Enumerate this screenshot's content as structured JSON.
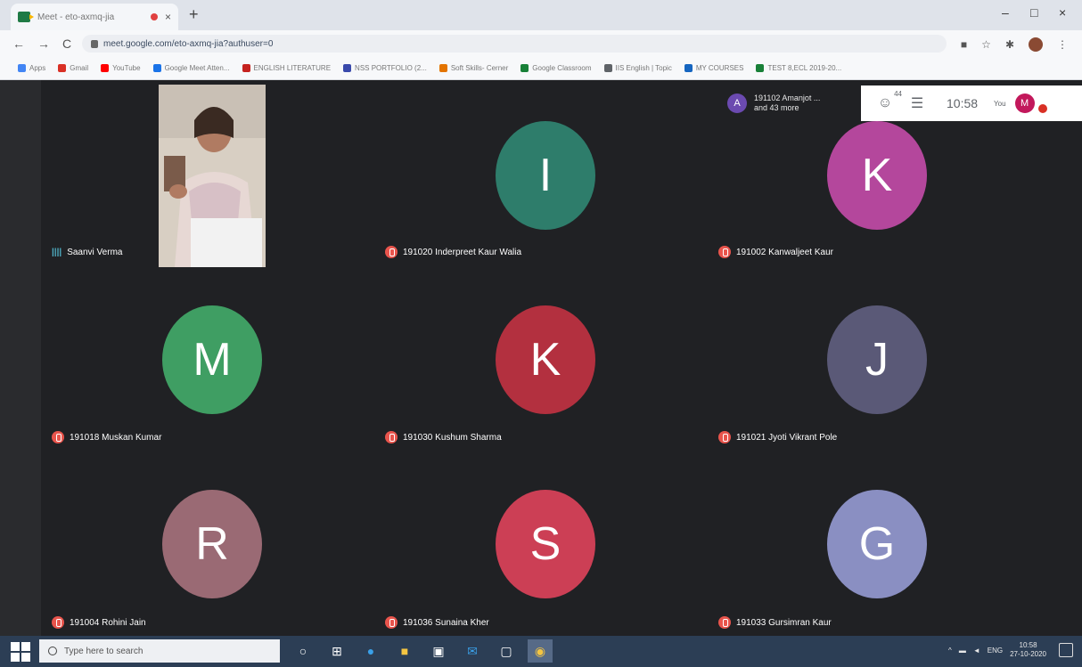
{
  "browser": {
    "tab_title": "Meet - eto-axmq-jia",
    "url": "meet.google.com/eto-axmq-jia?authuser=0",
    "window_controls": {
      "minimize": "–",
      "maximize": "□",
      "close": "×"
    },
    "nav": {
      "back": "←",
      "forward": "→",
      "reload": "C"
    },
    "new_tab": "+"
  },
  "bookmarks": [
    {
      "label": "Apps",
      "color": "#4285f4"
    },
    {
      "label": "Gmail",
      "color": "#d93025"
    },
    {
      "label": "YouTube",
      "color": "#ff0000"
    },
    {
      "label": "Google Meet Atten...",
      "color": "#1a73e8"
    },
    {
      "label": "ENGLISH LITERATURE",
      "color": "#c5221f"
    },
    {
      "label": "NSS PORTFOLIO (2...",
      "color": "#3949ab"
    },
    {
      "label": "Soft Skills- Cerner",
      "color": "#e37400"
    },
    {
      "label": "Google Classroom",
      "color": "#188038"
    },
    {
      "label": "IIS English | Topic",
      "color": "#5f6368"
    },
    {
      "label": "MY COURSES",
      "color": "#1565c0"
    },
    {
      "label": "TEST 8,ECL 2019-20...",
      "color": "#188038"
    }
  ],
  "meet": {
    "presenter": {
      "initial": "A",
      "line1": "191102 Amanjot ...",
      "line2": "and 43 more"
    },
    "participants_count": "44",
    "time": "10:58",
    "you_label": "You",
    "me_initial": "M",
    "self_view_name": "Saanvi Verma",
    "tiles": [
      {
        "initial": "I",
        "name": "191020 Inderpreet Kaur Walia",
        "color": "#2e7d6b"
      },
      {
        "initial": "K",
        "name": "191002 Kanwaljeet Kaur",
        "color": "#b4479c"
      },
      {
        "initial": "M",
        "name": "191018 Muskan Kumar",
        "color": "#3f9e63"
      },
      {
        "initial": "K",
        "name": "191030 Kushum Sharma",
        "color": "#b3303f"
      },
      {
        "initial": "J",
        "name": "191021 Jyoti Vikrant Pole",
        "color": "#5a5977"
      },
      {
        "initial": "R",
        "name": "191004 Rohini Jain",
        "color": "#9a6a74"
      },
      {
        "initial": "S",
        "name": "191036 Sunaina Kher",
        "color": "#cc3f55"
      },
      {
        "initial": "G",
        "name": "191033 Gursimran Kaur",
        "color": "#8a8fc2"
      }
    ]
  },
  "taskbar": {
    "search_placeholder": "Type here to search",
    "tray_lang": "ENG",
    "tray_time": "10:58",
    "tray_date": "27-10-2020"
  }
}
